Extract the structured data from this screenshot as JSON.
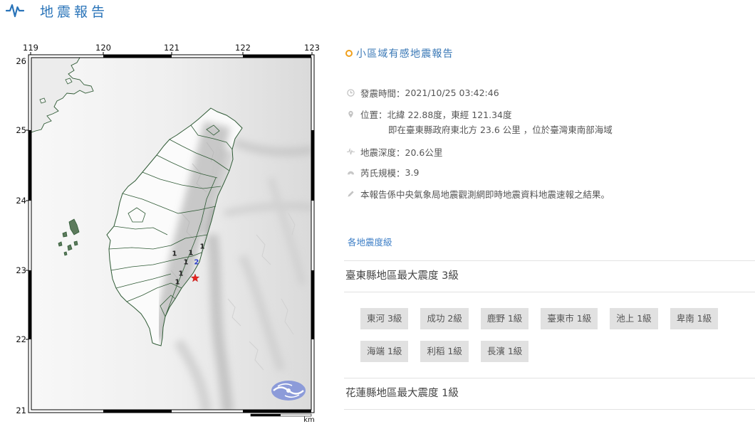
{
  "header": {
    "title": "地震報告",
    "icon": "seismograph-icon"
  },
  "map": {
    "lon_ticks": [
      "119",
      "120",
      "121",
      "122",
      "123"
    ],
    "lat_ticks": [
      "26",
      "25",
      "24",
      "23",
      "22",
      "21"
    ],
    "intensity_labels": [
      "1",
      "1",
      "1",
      "1",
      "2",
      "1",
      "1"
    ],
    "scale_unit": "km",
    "epicenter_icon": "red-star-icon",
    "logo_icon": "cwb-logo-icon"
  },
  "report": {
    "title": "小區域有感地震報告",
    "title_icon": "orange-ring-icon",
    "time": {
      "label": "發震時間：",
      "value": "2021/10/25 03:42:46",
      "icon": "clock-icon"
    },
    "location": {
      "label": "位置：",
      "value": "北緯 22.88度，東經 121.34度",
      "detail": "即在臺東縣政府東北方 23.6 公里 ，位於臺灣東南部海域",
      "icon": "map-pin-icon"
    },
    "depth": {
      "label": "地震深度：",
      "value": "20.6公里",
      "icon": "seismic-wave-icon"
    },
    "magnitude": {
      "label": "芮氏規模：",
      "value": "3.9",
      "icon": "magnitude-icon"
    },
    "note": {
      "text": "本報告係中央氣象局地震觀測網即時地震資料地震速報之結果。",
      "icon": "pencil-icon"
    }
  },
  "intensity": {
    "link_label": "各地震度級",
    "regions": [
      {
        "title": "臺東縣地區最大震度 3級",
        "stations": [
          "東河 3級",
          "成功 2級",
          "鹿野 1級",
          "臺東市 1級",
          "池上 1級",
          "卑南 1級",
          "海端 1級",
          "利稻 1級",
          "長濱 1級"
        ]
      },
      {
        "title": "花蓮縣地區最大震度 1級"
      }
    ]
  },
  "colors": {
    "brand_blue": "#2a74b9",
    "accent_orange": "#f0a01c",
    "epicenter_red": "#e5251f",
    "intensity_2_blue": "#2c3fc8",
    "badge_background": "#e1e1e1",
    "boundary_green": "#2f5a35"
  }
}
